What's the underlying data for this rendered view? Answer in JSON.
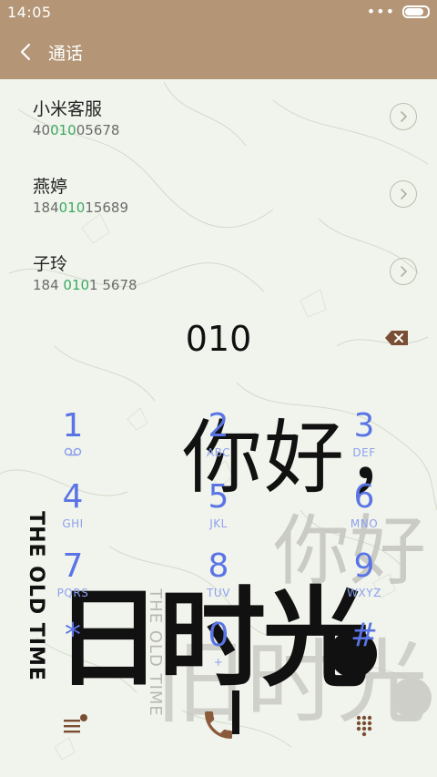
{
  "status_bar": {
    "time": "14:05",
    "battery_level": 0.9
  },
  "header": {
    "title": "通话"
  },
  "contacts": [
    {
      "name": "小米客服",
      "number_pre": "40",
      "number_match": "010",
      "number_post": "05678"
    },
    {
      "name": "燕婷",
      "number_pre": "184",
      "number_match": "010",
      "number_post": "15689"
    },
    {
      "name": "子玲",
      "number_pre": "184 ",
      "number_match": "010",
      "number_post": "1 5678"
    }
  ],
  "dialed_number": "010",
  "keypad": [
    {
      "digit": "1",
      "letters": ""
    },
    {
      "digit": "2",
      "letters": "ABC"
    },
    {
      "digit": "3",
      "letters": "DEF"
    },
    {
      "digit": "4",
      "letters": "GHI"
    },
    {
      "digit": "5",
      "letters": "JKL"
    },
    {
      "digit": "6",
      "letters": "MNO"
    },
    {
      "digit": "7",
      "letters": "PQRS"
    },
    {
      "digit": "8",
      "letters": "TUV"
    },
    {
      "digit": "9",
      "letters": "WXYZ"
    },
    {
      "digit": "*",
      "letters": ""
    },
    {
      "digit": "0",
      "letters": "+"
    },
    {
      "digit": "#",
      "letters": ""
    }
  ],
  "wallpaper": {
    "greeting": "你好，",
    "greeting_faded": "你好",
    "phrase": "日时光",
    "phrase_faded": "旧时光",
    "vertical_text": "THE OLD TIME",
    "vertical_text_faded": "THE OLD TIME"
  },
  "colors": {
    "header": "#b49677",
    "accent": "#3aaa62",
    "keypad_digit": "#5a74e6",
    "call_button": "#8a5a3c"
  },
  "icons": {
    "back": "chevron-left-icon",
    "detail": "chevron-right-circle-icon",
    "backspace": "backspace-icon",
    "menu": "menu-icon",
    "call": "phone-icon",
    "dialpad": "dialpad-icon"
  }
}
